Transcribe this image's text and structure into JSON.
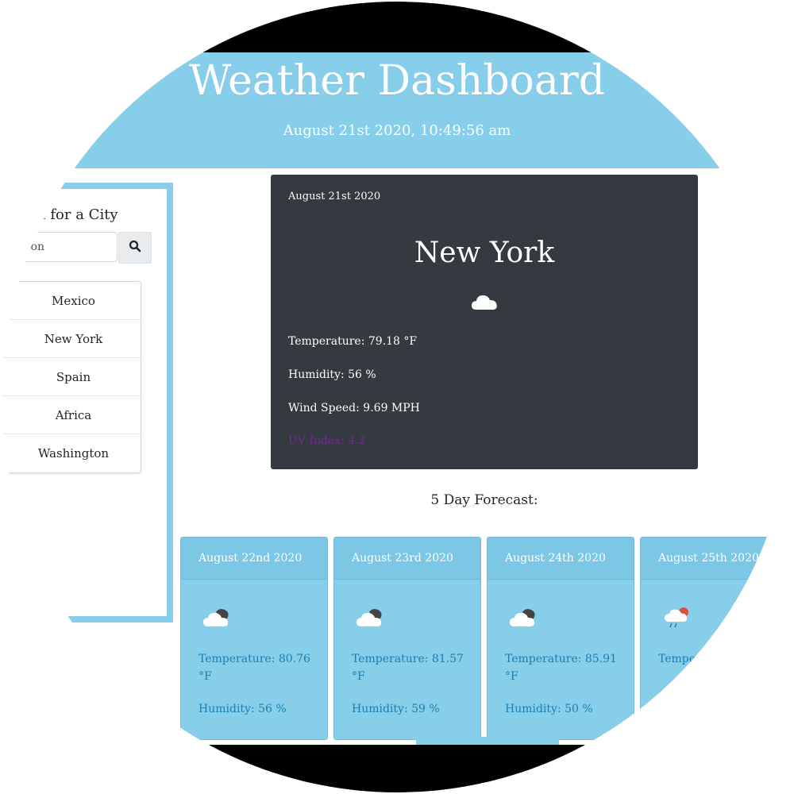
{
  "header": {
    "title": "Weather Dashboard",
    "datetime": "August 21st 2020, 10:49:56 am"
  },
  "sidebar": {
    "search_title": "ch for a City",
    "search_value": "gton",
    "search_icon": "search-icon",
    "cities": [
      "Mexico",
      "New York",
      "Spain",
      "Africa",
      "Washington"
    ]
  },
  "current": {
    "date": "August 21st 2020",
    "city": "New York",
    "icon": "cloud-icon",
    "temperature": "Temperature: 79.18 °F",
    "humidity": "Humidity: 56 %",
    "wind": "Wind Speed: 9.69 MPH",
    "uv": "UV Index: 4.2"
  },
  "forecast": {
    "title": "5 Day Forecast:",
    "days": [
      {
        "date": "August 22nd 2020",
        "icon": "cloudy-icon",
        "temp": "Temperature: 80.76 °F",
        "humidity": "Humidity: 56 %"
      },
      {
        "date": "August 23rd 2020",
        "icon": "cloudy-icon",
        "temp": "Temperature: 81.57 °F",
        "humidity": "Humidity: 59 %"
      },
      {
        "date": "August 24th 2020",
        "icon": "cloudy-icon",
        "temp": "Temperature: 85.91 °F",
        "humidity": "Humidity: 50 %"
      },
      {
        "date": "August 25th 2020",
        "icon": "rain-icon",
        "temp": "Tempe",
        "humidity": ""
      }
    ]
  },
  "colors": {
    "sky": "#87ceeb",
    "dark": "#343a40",
    "forecast_text": "#1a7fb0"
  }
}
